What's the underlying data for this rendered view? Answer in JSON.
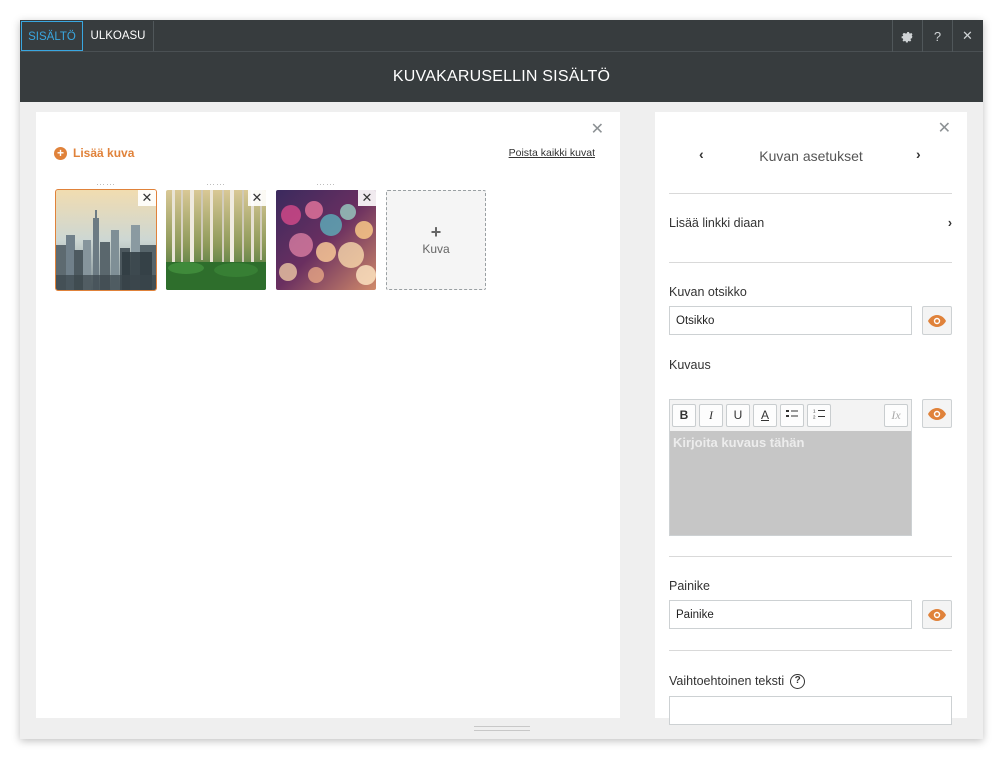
{
  "tabs": [
    {
      "label": "SISÄLTÖ",
      "active": true
    },
    {
      "label": "ULKOASU",
      "active": false
    }
  ],
  "toolbar_icons": [
    "gear-icon",
    "help-icon",
    "close-icon"
  ],
  "toolbar_glyphs": {
    "help": "?",
    "close": "✕"
  },
  "header": {
    "title": "KUVAKARUSELLIN SISÄLTÖ"
  },
  "left_panel": {
    "close_glyph": "✕",
    "add_image_label": "Lisää kuva",
    "remove_all_label": "Poista kaikki kuvat",
    "thumbnails": [
      {
        "name": "city-skyline",
        "selected": true
      },
      {
        "name": "birch-forest",
        "selected": false
      },
      {
        "name": "bokeh-lights",
        "selected": false
      }
    ],
    "thumb_remove_glyph": "✕",
    "add_tile": {
      "plus": "+",
      "label": "Kuva"
    }
  },
  "right_panel": {
    "close_glyph": "✕",
    "nav": {
      "prev": "‹",
      "title": "Kuvan asetukset",
      "next": "›"
    },
    "link_row": {
      "label": "Lisää linkki diaan",
      "chevron": "›"
    },
    "title_field": {
      "label": "Kuvan otsikko",
      "value": "Otsikko"
    },
    "description": {
      "label": "Kuvaus",
      "placeholder": "Kirjoita kuvaus tähän",
      "toolbar": {
        "bold": "B",
        "italic": "I",
        "underline": "U",
        "color": "A",
        "clear": "Ix"
      }
    },
    "button_field": {
      "label": "Painike",
      "value": "Painike"
    },
    "alt_field": {
      "label": "Vaihtoehtoinen teksti",
      "help": "?",
      "value": ""
    }
  },
  "colors": {
    "accent": "#e0823a",
    "tab_active": "#39a7e0",
    "dark_bar": "#373c3e"
  }
}
